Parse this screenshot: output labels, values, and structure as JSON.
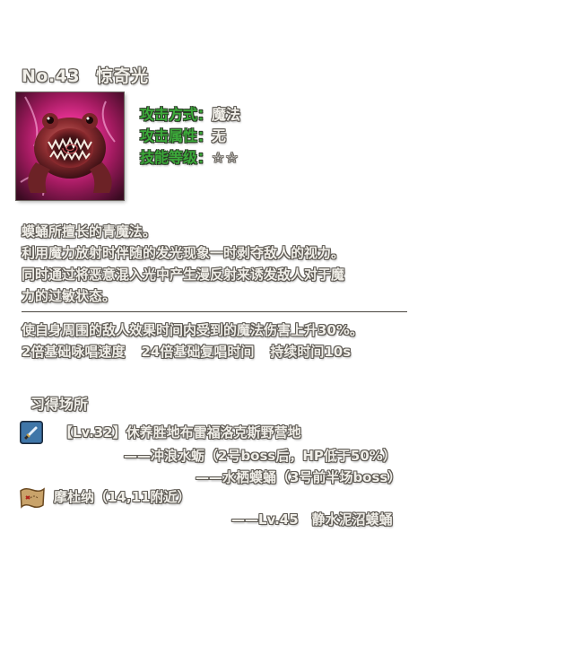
{
  "skill": {
    "number": "No.43",
    "name": "惊奇光",
    "attributes": [
      {
        "key": "攻击方式：",
        "value": "魔法"
      },
      {
        "key": "攻击属性：",
        "value": "无"
      },
      {
        "key": "技能等级：",
        "value": "☆☆"
      }
    ],
    "description": [
      "蟆蛹所擅长的青魔法。",
      "利用魔力放射时伴随的发光现象一时剥夺敌人的视力。",
      "同时通过将恶意混入光中产生漫反射来诱发敌人对于魔",
      "力的过敏状态。"
    ],
    "effect": {
      "line1": "使自身周围的敌人效果时间内受到的魔法伤害上升30%。",
      "cast_speed": "2倍基础咏唱速度",
      "recast": "24倍基础复唱时间",
      "duration": "持续时间10s"
    }
  },
  "acquisition": {
    "title": "习得场所",
    "sources": [
      {
        "icon": "dungeon-sword-icon",
        "location": "【Lv.32】休养胜地布雷福洛克斯野营地",
        "details": [
          "——冲浪水蛎（2号boss后，HP低于50%）",
          "——水栖蟆蛹（3号前半场boss）"
        ]
      },
      {
        "icon": "treasure-map-icon",
        "location": "摩杜纳（14,11附近）",
        "details": [
          "——Lv.45　静水泥沼蟆蛹"
        ]
      }
    ]
  },
  "colors": {
    "attr_key": "#3cab3a",
    "text_fill": "#f1efe9",
    "text_outline": "#5e5a54",
    "portrait_glow": "#e8208a"
  }
}
